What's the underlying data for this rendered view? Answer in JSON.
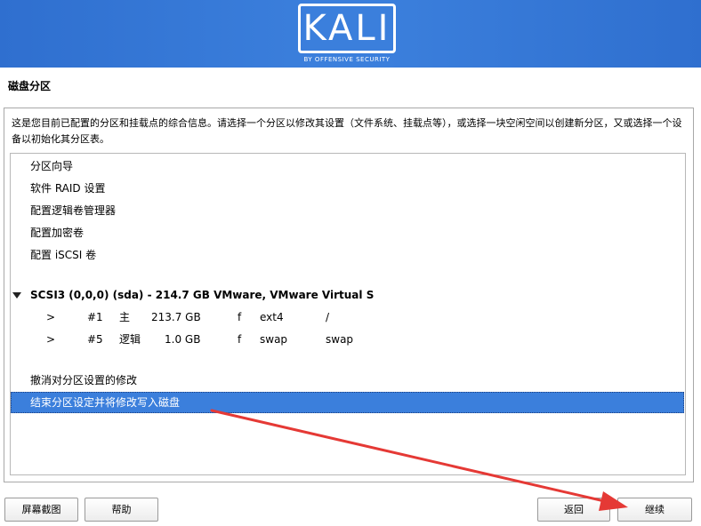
{
  "banner": {
    "logo": "KALI",
    "tagline": "BY OFFENSIVE SECURITY"
  },
  "section_title": "磁盘分区",
  "description": "这是您目前已配置的分区和挂载点的综合信息。请选择一个分区以修改其设置（文件系统、挂载点等），或选择一块空闲空间以创建新分区，又或选择一个设备以初始化其分区表。",
  "menu_items": [
    {
      "label": "分区向导"
    },
    {
      "label": "软件 RAID 设置"
    },
    {
      "label": "配置逻辑卷管理器"
    },
    {
      "label": "配置加密卷"
    },
    {
      "label": "配置 iSCSI 卷"
    }
  ],
  "disk": {
    "label": "SCSI3 (0,0,0) (sda) - 214.7 GB VMware, VMware Virtual S",
    "partitions": [
      {
        "arrow": ">",
        "num": "#1",
        "type": "主",
        "size": "213.7 GB",
        "flag": "f",
        "fs": "ext4",
        "mount": "/"
      },
      {
        "arrow": ">",
        "num": "#5",
        "type": "逻辑",
        "size": "1.0 GB",
        "flag": "f",
        "fs": "swap",
        "mount": "swap"
      }
    ]
  },
  "actions": {
    "undo": "撤消对分区设置的修改",
    "finish": "结束分区设定并将修改写入磁盘"
  },
  "buttons": {
    "screenshot": "屏幕截图",
    "help": "帮助",
    "back": "返回",
    "continue": "继续"
  },
  "colors": {
    "banner": "#3b7fdc",
    "selection": "#3b7fdc",
    "annotation_arrow": "#e53935"
  }
}
